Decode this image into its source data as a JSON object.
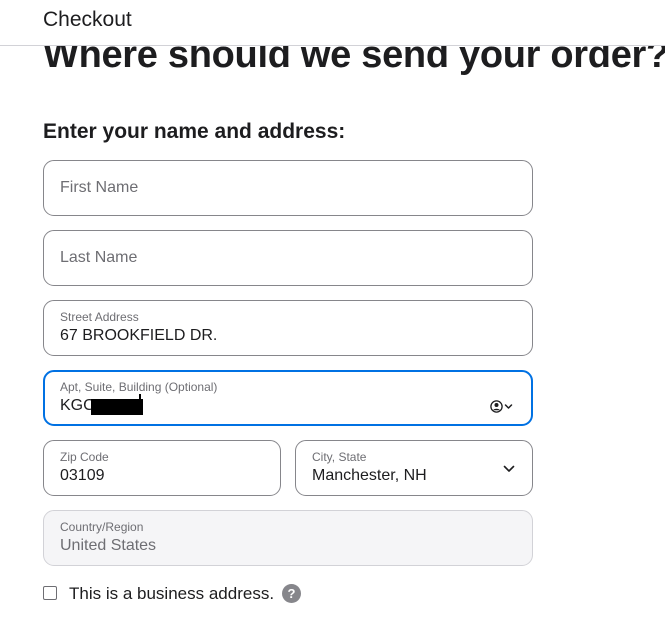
{
  "header": {
    "title": "Checkout"
  },
  "page": {
    "headline": "Where should we send your order?",
    "section_heading": "Enter your name and address:"
  },
  "form": {
    "first_name": {
      "placeholder": "First Name",
      "value": ""
    },
    "last_name": {
      "placeholder": "Last Name",
      "value": ""
    },
    "street_address": {
      "label": "Street Address",
      "value": "67 BROOKFIELD DR."
    },
    "apt_suite": {
      "label": "Apt, Suite, Building (Optional)",
      "value": "KGC",
      "redacted": true
    },
    "zip_code": {
      "label": "Zip Code",
      "value": "03109"
    },
    "city_state": {
      "label": "City, State",
      "value": "Manchester, NH"
    },
    "country": {
      "label": "Country/Region",
      "value": "United States"
    },
    "business_address": {
      "label": "This is a business address.",
      "checked": false,
      "help_icon": "?"
    }
  },
  "colors": {
    "focus_accent": "#0071e3",
    "text_primary": "#1d1d1f",
    "text_secondary": "#6e6e73"
  },
  "icons": {
    "autofill": "contact-autofill-icon",
    "dropdown": "chevron-down-icon",
    "help": "question-mark-icon"
  }
}
